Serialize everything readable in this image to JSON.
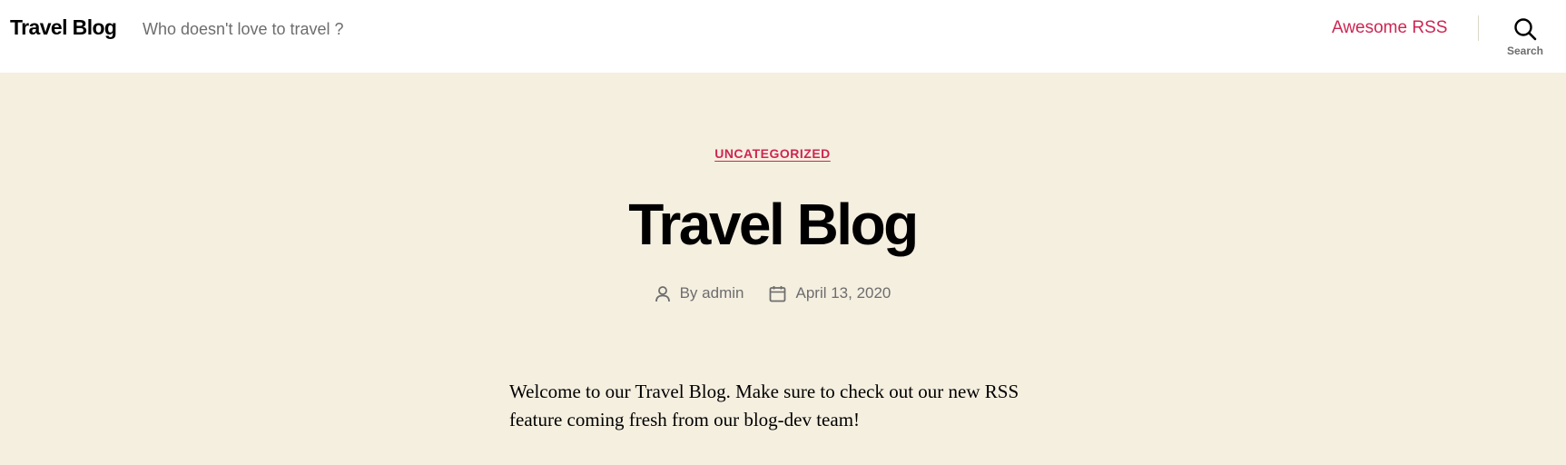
{
  "header": {
    "site_title": "Travel Blog",
    "site_description": "Who doesn't love to travel ?",
    "nav": [
      {
        "label": "Awesome RSS"
      }
    ],
    "search": {
      "label": "Search",
      "icon": "search-icon"
    }
  },
  "post": {
    "category": "UNCATEGORIZED",
    "title": "Travel Blog",
    "meta": {
      "author_prefix": "By",
      "author": "admin",
      "author_icon": "user-icon",
      "date": "April 13, 2020",
      "date_icon": "calendar-icon"
    },
    "content": "Welcome to our Travel Blog. Make sure to check out our new RSS feature coming fresh from our blog-dev team!"
  },
  "colors": {
    "accent": "#cd2653",
    "background": "#f5efe0",
    "header_bg": "#ffffff",
    "secondary_text": "#6d6d6d"
  }
}
